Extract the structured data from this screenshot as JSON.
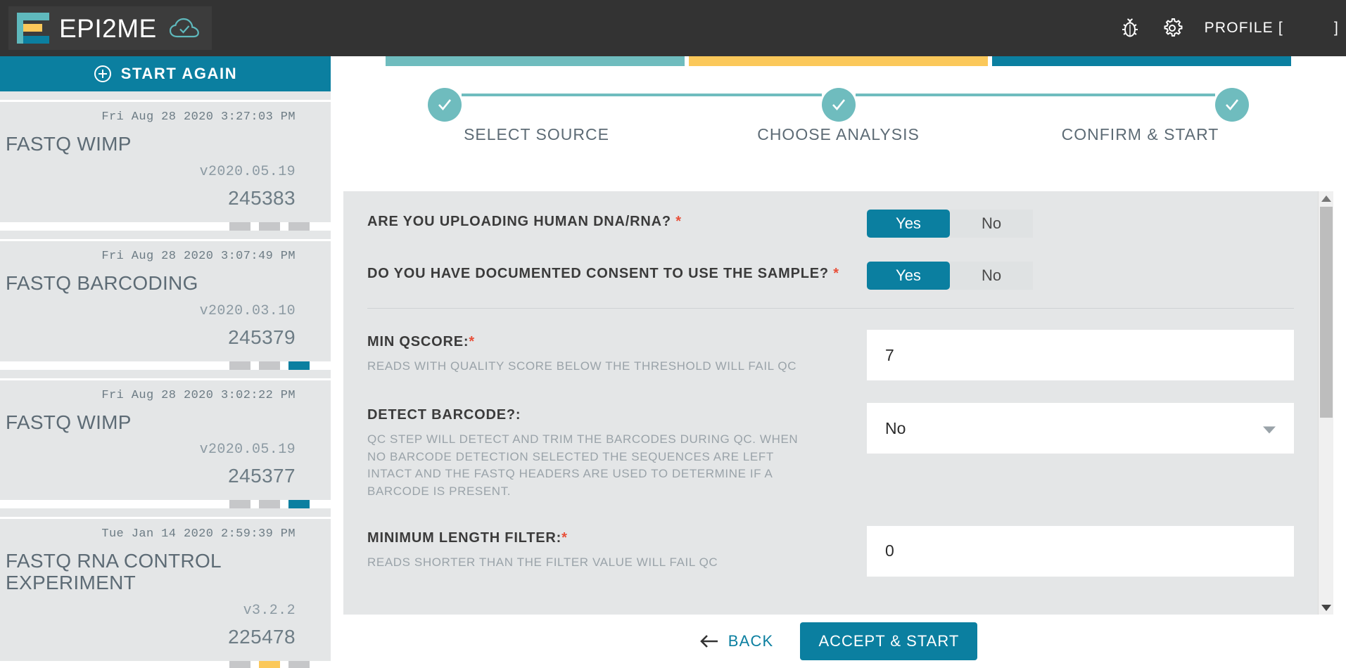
{
  "header": {
    "brand": "EPI2ME",
    "cloud_icon": "cloud-check-icon",
    "bug_icon": "bug-icon",
    "gear_icon": "gear-icon",
    "profile_prefix": "PROFILE [",
    "profile_suffix": "]"
  },
  "sidebar": {
    "start_again_label": "START AGAIN",
    "plus_icon": "plus-circle-icon",
    "workflows": [
      {
        "date": "Fri Aug 28 2020 3:27:03 PM",
        "name": "FASTQ WIMP",
        "version": "v2020.05.19",
        "id": "245383",
        "segments": [
          "gray",
          "gray",
          "gray"
        ]
      },
      {
        "date": "Fri Aug 28 2020 3:07:49 PM",
        "name": "FASTQ BARCODING",
        "version": "v2020.03.10",
        "id": "245379",
        "segments": [
          "gray",
          "gray",
          "blue"
        ]
      },
      {
        "date": "Fri Aug 28 2020 3:02:22 PM",
        "name": "FASTQ WIMP",
        "version": "v2020.05.19",
        "id": "245377",
        "segments": [
          "gray",
          "gray",
          "blue"
        ]
      },
      {
        "date": "Tue Jan 14 2020 2:59:39 PM",
        "name": "FASTQ RNA CONTROL EXPERIMENT",
        "version": "v3.2.2",
        "id": "225478",
        "segments": [
          "gray",
          "yellow",
          "gray"
        ]
      }
    ]
  },
  "stepper": {
    "steps": [
      {
        "label": "SELECT SOURCE",
        "state": "complete",
        "bar_color": "#6fbcbe"
      },
      {
        "label": "CHOOSE ANALYSIS",
        "state": "complete",
        "bar_color": "#fbc85a"
      },
      {
        "label": "CONFIRM & START",
        "state": "complete",
        "bar_color": "#0b7fa0"
      }
    ],
    "check_icon": "check-icon"
  },
  "form": {
    "questions": [
      {
        "label": "ARE YOU UPLOADING HUMAN DNA/RNA?",
        "required": true,
        "options": [
          "Yes",
          "No"
        ],
        "selected": "Yes"
      },
      {
        "label": "DO YOU HAVE DOCUMENTED CONSENT TO USE THE SAMPLE?",
        "required": true,
        "options": [
          "Yes",
          "No"
        ],
        "selected": "Yes"
      }
    ],
    "fields": [
      {
        "label": "MIN QSCORE:",
        "required": true,
        "help": "READS WITH QUALITY SCORE BELOW THE THRESHOLD WILL FAIL QC",
        "type": "text",
        "value": "7"
      },
      {
        "label": "DETECT BARCODE?:",
        "required": false,
        "help": "QC STEP WILL DETECT AND TRIM THE BARCODES DURING QC. WHEN NO BARCODE DETECTION SELECTED THE SEQUENCES ARE LEFT INTACT AND THE FASTQ HEADERS ARE USED TO DETERMINE IF A BARCODE IS PRESENT.",
        "type": "select",
        "value": "No",
        "caret_icon": "chevron-down-icon"
      },
      {
        "label": "MINIMUM LENGTH FILTER:",
        "required": true,
        "help": "READS SHORTER THAN THE FILTER VALUE WILL FAIL QC",
        "type": "text",
        "value": "0"
      }
    ]
  },
  "footer": {
    "back_label": "BACK",
    "back_icon": "arrow-left-icon",
    "accept_label": "ACCEPT & START"
  },
  "colors": {
    "brand_blue": "#0b7fa0",
    "teal": "#6fbcbe",
    "yellow": "#fbc85a",
    "required_red": "#e8503a",
    "dark_header": "#333333",
    "panel_gray": "#e4e6e7"
  }
}
